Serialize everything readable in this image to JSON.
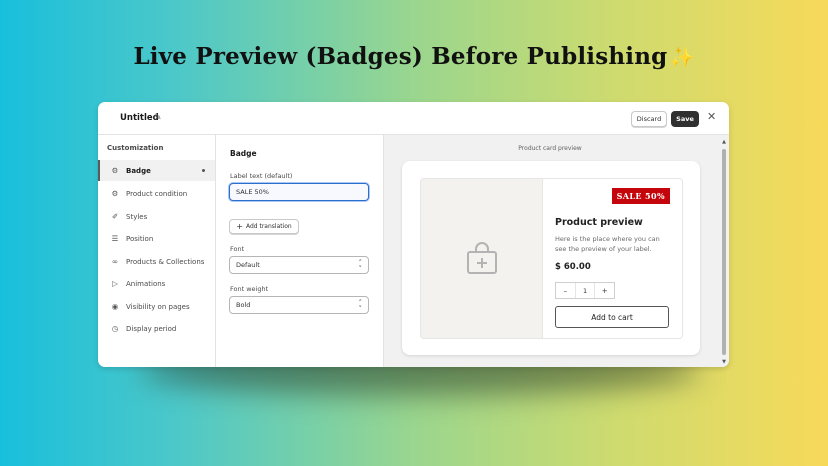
{
  "headline": "Live Preview (Badges) Before Publishing",
  "headline_emoji": "✨",
  "topbar": {
    "title": "Untitled",
    "discard_label": "Discard",
    "save_label": "Save"
  },
  "sidebar": {
    "header": "Customization",
    "items": [
      {
        "label": "Badge",
        "icon": "badge-icon"
      },
      {
        "label": "Product condition",
        "icon": "product-condition-icon"
      },
      {
        "label": "Styles",
        "icon": "brush-icon"
      },
      {
        "label": "Position",
        "icon": "layout-icon"
      },
      {
        "label": "Products & Collections",
        "icon": "link-icon"
      },
      {
        "label": "Animations",
        "icon": "play-icon"
      },
      {
        "label": "Visibility on pages",
        "icon": "eye-icon"
      },
      {
        "label": "Display period",
        "icon": "clock-icon"
      }
    ]
  },
  "form": {
    "title": "Badge",
    "label_text_label": "Label text (default)",
    "label_text_value": "SALE 50%",
    "add_translation_label": "Add translation",
    "font_label": "Font",
    "font_value": "Default",
    "font_weight_label": "Font weight",
    "font_weight_value": "Bold"
  },
  "preview": {
    "caption": "Product card preview",
    "badge_text": "SALE 50%",
    "product_name": "Product preview",
    "description": "Here is the place where you can see the preview of your label.",
    "price": "$ 60.00",
    "qty_minus": "–",
    "qty_value": "1",
    "qty_plus": "+",
    "add_to_cart_label": "Add to cart"
  },
  "colors": {
    "badge_bg": "#c5050c",
    "focus_border": "#2c6ecb",
    "save_bg": "#303030"
  }
}
